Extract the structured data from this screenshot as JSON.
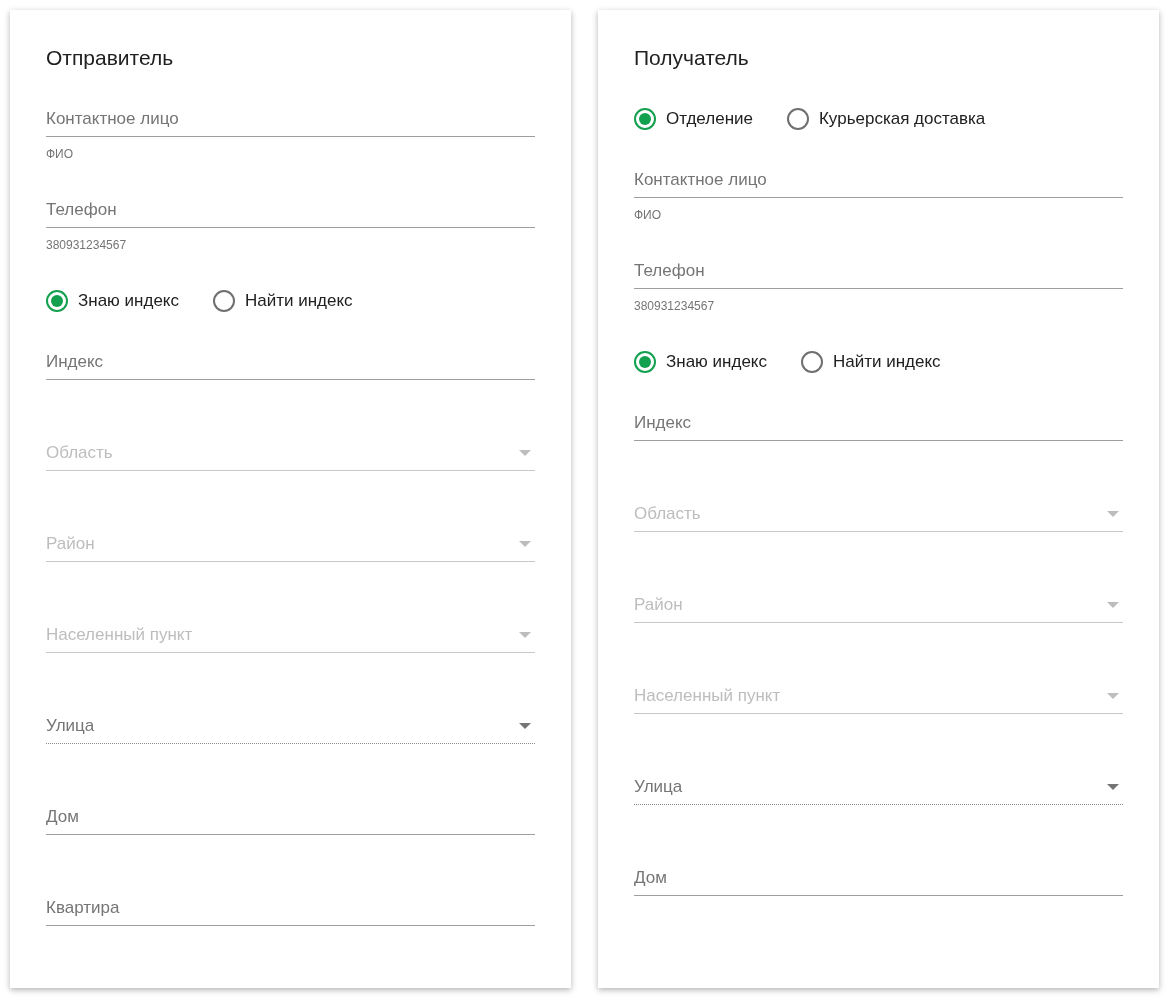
{
  "cards": [
    {
      "title": "Отправитель",
      "items": [
        {
          "kind": "text",
          "placeholder": "Контактное лицо",
          "helper": "ФИО"
        },
        {
          "kind": "text",
          "placeholder": "Телефон",
          "helper": "380931234567"
        },
        {
          "kind": "radios",
          "options": [
            {
              "label": "Знаю индекс",
              "selected": true
            },
            {
              "label": "Найти индекс",
              "selected": false
            }
          ]
        },
        {
          "kind": "text",
          "placeholder": "Индекс"
        },
        {
          "kind": "select",
          "placeholder": "Область",
          "disabled": true
        },
        {
          "kind": "select",
          "placeholder": "Район",
          "disabled": true
        },
        {
          "kind": "select",
          "placeholder": "Населенный пункт",
          "disabled": true
        },
        {
          "kind": "select",
          "placeholder": "Улица",
          "disabled": false
        },
        {
          "kind": "text",
          "placeholder": "Дом"
        },
        {
          "kind": "text",
          "placeholder": "Квартира"
        }
      ]
    },
    {
      "title": "Получатель",
      "items": [
        {
          "kind": "radios",
          "options": [
            {
              "label": "Отделение",
              "selected": true
            },
            {
              "label": "Курьерская доставка",
              "selected": false
            }
          ]
        },
        {
          "kind": "text",
          "placeholder": "Контактное лицо",
          "helper": "ФИО"
        },
        {
          "kind": "text",
          "placeholder": "Телефон",
          "helper": "380931234567"
        },
        {
          "kind": "radios",
          "options": [
            {
              "label": "Знаю индекс",
              "selected": true
            },
            {
              "label": "Найти индекс",
              "selected": false
            }
          ]
        },
        {
          "kind": "text",
          "placeholder": "Индекс"
        },
        {
          "kind": "select",
          "placeholder": "Область",
          "disabled": true
        },
        {
          "kind": "select",
          "placeholder": "Район",
          "disabled": true
        },
        {
          "kind": "select",
          "placeholder": "Населенный пункт",
          "disabled": true
        },
        {
          "kind": "select",
          "placeholder": "Улица",
          "disabled": false
        },
        {
          "kind": "text",
          "placeholder": "Дом"
        }
      ]
    }
  ]
}
